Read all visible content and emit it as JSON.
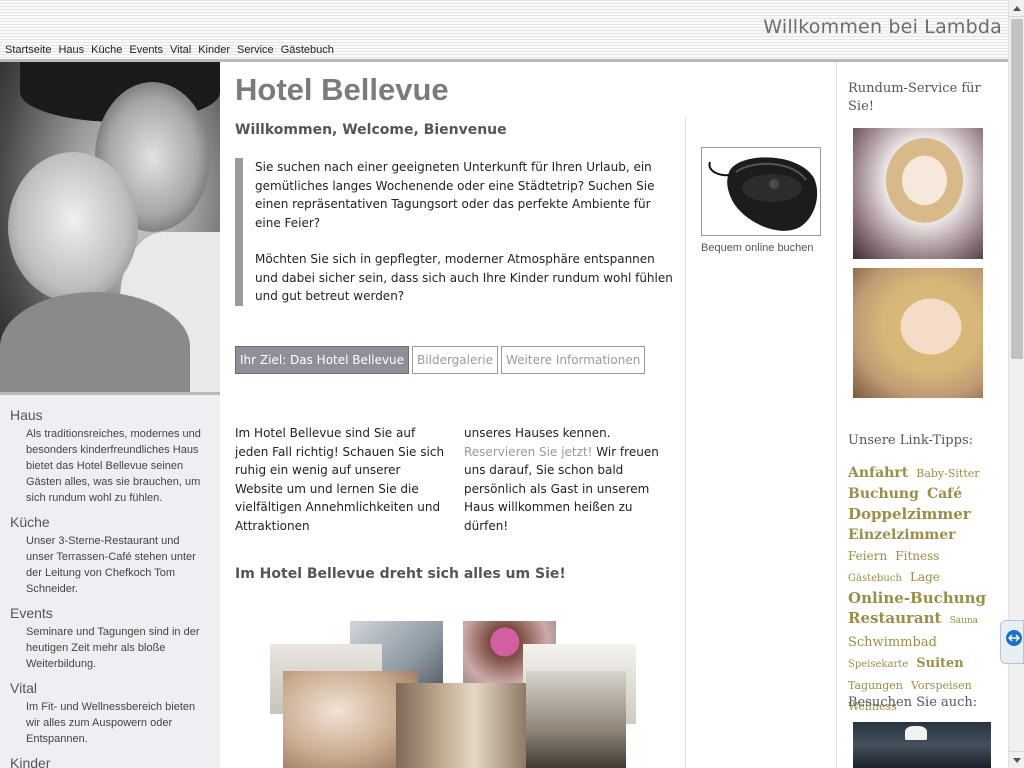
{
  "header": {
    "welcome": "Willkommen bei Lambda",
    "nav": [
      "Startseite",
      "Haus",
      "Küche",
      "Events",
      "Vital",
      "Kinder",
      "Service",
      "Gästebuch"
    ]
  },
  "left": {
    "sections": [
      {
        "title": "Haus",
        "text": "Als traditionsreiches, modernes und besonders kinderfreundliches Haus bietet das Hotel Bellevue seinen Gästen alles, was sie brauchen, um sich rundum wohl zu fühlen."
      },
      {
        "title": "Küche",
        "text": "Unser 3-Sterne-Restaurant und unser Terrassen-Café stehen unter der Leitung von Chefkoch Tom Schneider."
      },
      {
        "title": "Events",
        "text": "Seminare und Tagungen sind in der heutigen Zeit mehr als bloße Weiterbildung."
      },
      {
        "title": "Vital",
        "text": "Im Fit- und Wellnessbereich bieten wir alles zum Auspowern oder Entspannen."
      },
      {
        "title": "Kinder",
        "text": ""
      }
    ]
  },
  "main": {
    "title": "Hotel Bellevue",
    "subtitle": "Willkommen, Welcome, Bienvenue",
    "quote": [
      "Sie suchen nach einer geeigneten Unterkunft für Ihren Urlaub, ein gemütliches langes Wochenende oder eine Städtetrip? Suchen Sie einen repräsentativen Tagungsort oder das perfekte Ambiente für eine Feier?",
      "Möchten Sie sich in gepflegter, moderner Atmosphäre entspannen und dabei sicher sein, dass sich auch Ihre Kinder rundum wohl fühlen und gut betreut werden?"
    ],
    "tabs": [
      "Ihr Ziel: Das Hotel Bellevue",
      "Bildergalerie",
      "Weitere Informationen"
    ],
    "col1": "Im Hotel Bellevue sind Sie auf jeden Fall richtig! Schauen Sie sich ruhig ein wenig auf unserer Website um und lernen Sie die vielfältigen Annehmlichkeiten und Attraktionen",
    "col2_before": "unseres Hauses kennen. ",
    "col2_link": "Reservieren Sie jetzt!",
    "col2_after": " Wir freuen uns darauf, Sie schon bald persönlich als Gast in unserem Haus willkommen heißen zu dürfen!",
    "heading2": "Im Hotel Bellevue dreht sich alles um Sie!"
  },
  "ad": {
    "caption": "Bequem online buchen"
  },
  "right": {
    "service_title": "Rundum-Service für Sie!",
    "links_title": "Unsere Link-Tipps:",
    "visit_title": "Besuchen Sie auch:",
    "tags": [
      {
        "label": "Anfahrt",
        "size": 14,
        "bold": true
      },
      {
        "label": "Baby-Sitter",
        "size": 11,
        "bold": false
      },
      {
        "label": "Buchung",
        "size": 14,
        "bold": true
      },
      {
        "label": "Café",
        "size": 14,
        "bold": true
      },
      {
        "label": "Doppelzimmer",
        "size": 15,
        "bold": true
      },
      {
        "label": "Einzelzimmer",
        "size": 14,
        "bold": true
      },
      {
        "label": "Feiern",
        "size": 12,
        "bold": false
      },
      {
        "label": "Fitness",
        "size": 12,
        "bold": false
      },
      {
        "label": "Gästebuch",
        "size": 10,
        "bold": false
      },
      {
        "label": "Lage",
        "size": 12,
        "bold": false
      },
      {
        "label": "Online-Buchung",
        "size": 15,
        "bold": true
      },
      {
        "label": "Restaurant",
        "size": 15,
        "bold": true
      },
      {
        "label": "Sauna",
        "size": 9,
        "bold": false
      },
      {
        "label": "Schwimmbad",
        "size": 13,
        "bold": false
      },
      {
        "label": "Speisekarte",
        "size": 10,
        "bold": false
      },
      {
        "label": "Suiten",
        "size": 13,
        "bold": true
      },
      {
        "label": "Tagungen",
        "size": 11,
        "bold": false
      },
      {
        "label": "Vorspeisen",
        "size": 11,
        "bold": false
      },
      {
        "label": "Wellness",
        "size": 11,
        "bold": false
      }
    ]
  },
  "colors": {
    "accent_gray": "#8f8f99",
    "tag_gold": "#9a8e48",
    "title_gray": "#7b7b7b"
  }
}
